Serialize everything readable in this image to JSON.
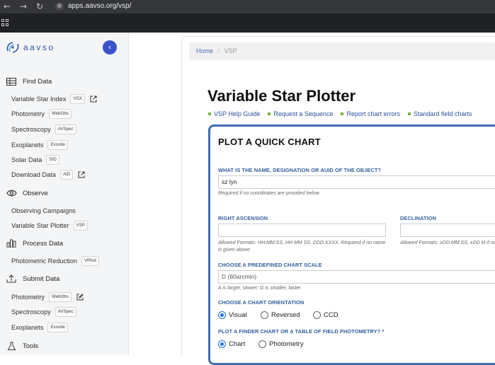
{
  "browser": {
    "url": "apps.aavso.org/vsp/",
    "back_icon": "←",
    "forward_icon": "→",
    "reload_icon": "↻"
  },
  "sidebar": {
    "logo_text": "aavso",
    "collapse_icon": "‹",
    "sections": [
      {
        "title": "Find Data",
        "icon": "table-icon",
        "items": [
          {
            "label": "Variable Star Index",
            "badge": "VSX",
            "external": true
          },
          {
            "label": "Photometry",
            "badge": "WebObs",
            "external": false
          },
          {
            "label": "Spectroscopy",
            "badge": "AVSpec",
            "external": false
          },
          {
            "label": "Exoplanets",
            "badge": "Exosite",
            "external": false
          },
          {
            "label": "Solar Data",
            "badge": "SID",
            "external": false
          },
          {
            "label": "Download Data",
            "badge": "AID",
            "external": true
          }
        ]
      },
      {
        "title": "Observe",
        "icon": "eye-icon",
        "items": [
          {
            "label": "Observing Campaigns",
            "badge": "",
            "external": false
          },
          {
            "label": "Variable Star Plotter",
            "badge": "VSP",
            "external": false
          }
        ]
      },
      {
        "title": "Process Data",
        "icon": "bar-chart-icon",
        "items": [
          {
            "label": "Photometric Reduction",
            "badge": "VPhot",
            "external": false
          }
        ]
      },
      {
        "title": "Submit Data",
        "icon": "upload-icon",
        "items": [
          {
            "label": "Photometry",
            "badge": "WebObs",
            "external": true
          },
          {
            "label": "Spectroscopy",
            "badge": "AVSpec",
            "external": false
          },
          {
            "label": "Exoplanets",
            "badge": "Exosite",
            "external": false
          }
        ]
      },
      {
        "title": "Tools",
        "icon": "flask-icon",
        "items": []
      }
    ]
  },
  "breadcrumb": {
    "home": "Home",
    "separator": "/",
    "current": "VSP"
  },
  "page": {
    "title": "Variable Star Plotter",
    "links": [
      "VSP Help Guide",
      "Request a Sequence",
      "Report chart errors",
      "Standard field charts"
    ]
  },
  "form": {
    "title": "PLOT A QUICK CHART",
    "object_label": "WHAT IS THE NAME, DESIGNATION OR AUID OF THE OBJECT?",
    "object_value": "sz lyn",
    "object_help": "Required if no coordinates are provided below",
    "ra_label": "RIGHT ASCENSION",
    "ra_value": "",
    "ra_help": "Allowed Formats: HH:MM:SS, HH MM SS, DDD.XXXX. Required if no name is given above",
    "dec_label": "DECLINATION",
    "dec_value": "",
    "dec_help": "Allowed Formats: ±DD:MM:SS, ±DD M if no name is given above",
    "scale_label": "CHOOSE A PREDEFINED CHART SCALE",
    "scale_value": "D (60arcmin)",
    "scale_help": "A is larger, slower; G is smaller, faster",
    "orientation_label": "CHOOSE A CHART ORIENTATION",
    "orientation_options": [
      "Visual",
      "Reversed",
      "CCD"
    ],
    "orientation_selected": "Visual",
    "type_label": "PLOT A FINDER CHART OR A TABLE OF FIELD PHOTOMETRY? *",
    "type_options": [
      "Chart",
      "Photometry"
    ],
    "type_selected": "Chart"
  },
  "colors": {
    "accent": "#3f6fb2",
    "label": "#2f5d9c",
    "collapse_button": "#3a53c8",
    "link_bullet": "#7cb342"
  }
}
